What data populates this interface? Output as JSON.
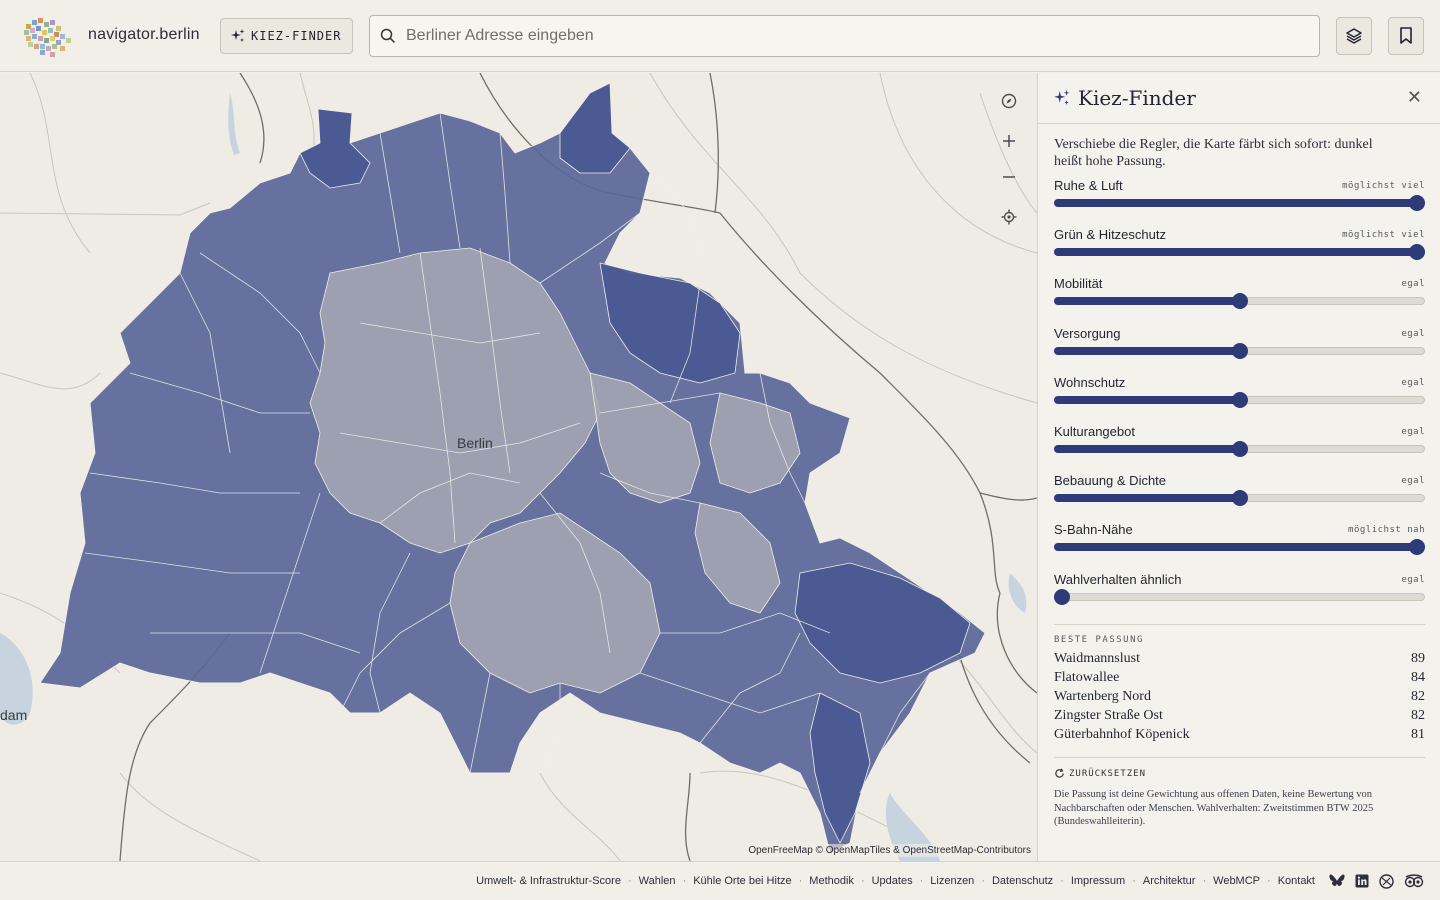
{
  "header": {
    "brand": "navigator.berlin",
    "kiez_button": "KIEZ-FINDER",
    "search_placeholder": "Berliner Adresse eingeben"
  },
  "map": {
    "city_label": "Berlin",
    "edge_label": "dam",
    "attribution": "OpenFreeMap © OpenMapTiles & OpenStreetMap-Contributors",
    "fill_color": "#4e5c98",
    "light_fill_color": "#9a9ba8"
  },
  "panel": {
    "title": "Kiez-Finder",
    "intro": "Verschiebe die Regler, die Karte färbt sich sofort: dunkel heißt hohe Passung.",
    "sliders": [
      {
        "name": "Ruhe & Luft",
        "hint": "möglichst viel",
        "value": 1.0
      },
      {
        "name": "Grün & Hitzeschutz",
        "hint": "möglichst viel",
        "value": 1.0
      },
      {
        "name": "Mobilität",
        "hint": "egal",
        "value": 0.5
      },
      {
        "name": "Versorgung",
        "hint": "egal",
        "value": 0.5
      },
      {
        "name": "Wohnschutz",
        "hint": "egal",
        "value": 0.5
      },
      {
        "name": "Kulturangebot",
        "hint": "egal",
        "value": 0.5
      },
      {
        "name": "Bebauung & Dichte",
        "hint": "egal",
        "value": 0.5
      },
      {
        "name": "S-Bahn-Nähe",
        "hint": "möglichst nah",
        "value": 1.0
      },
      {
        "name": "Wahlverhalten ähnlich",
        "hint": "egal",
        "value": 0.0
      }
    ],
    "best_title": "BESTE PASSUNG",
    "best": [
      {
        "name": "Waidmannslust",
        "score": "89"
      },
      {
        "name": "Flatowallee",
        "score": "84"
      },
      {
        "name": "Wartenberg Nord",
        "score": "82"
      },
      {
        "name": "Zingster Straße Ost",
        "score": "82"
      },
      {
        "name": "Güterbahnhof Köpenick",
        "score": "81"
      }
    ],
    "reset": "ZURÜCKSETZEN",
    "note": "Die Passung ist deine Gewichtung aus offenen Daten, keine Bewertung von Nachbarschaften oder Menschen. Wahlverhalten: Zweitstimmen BTW 2025 (Bundeswahlleiterin)."
  },
  "footer": {
    "links": [
      "Umwelt- & Infrastruktur-Score",
      "Wahlen",
      "Kühle Orte bei Hitze",
      "Methodik",
      "Updates",
      "Lizenzen",
      "Datenschutz",
      "Impressum",
      "Architektur",
      "WebMCP",
      "Kontakt"
    ],
    "separator": "·"
  },
  "colors": {
    "accent": "#2e3b78",
    "background": "#f1efe8"
  }
}
